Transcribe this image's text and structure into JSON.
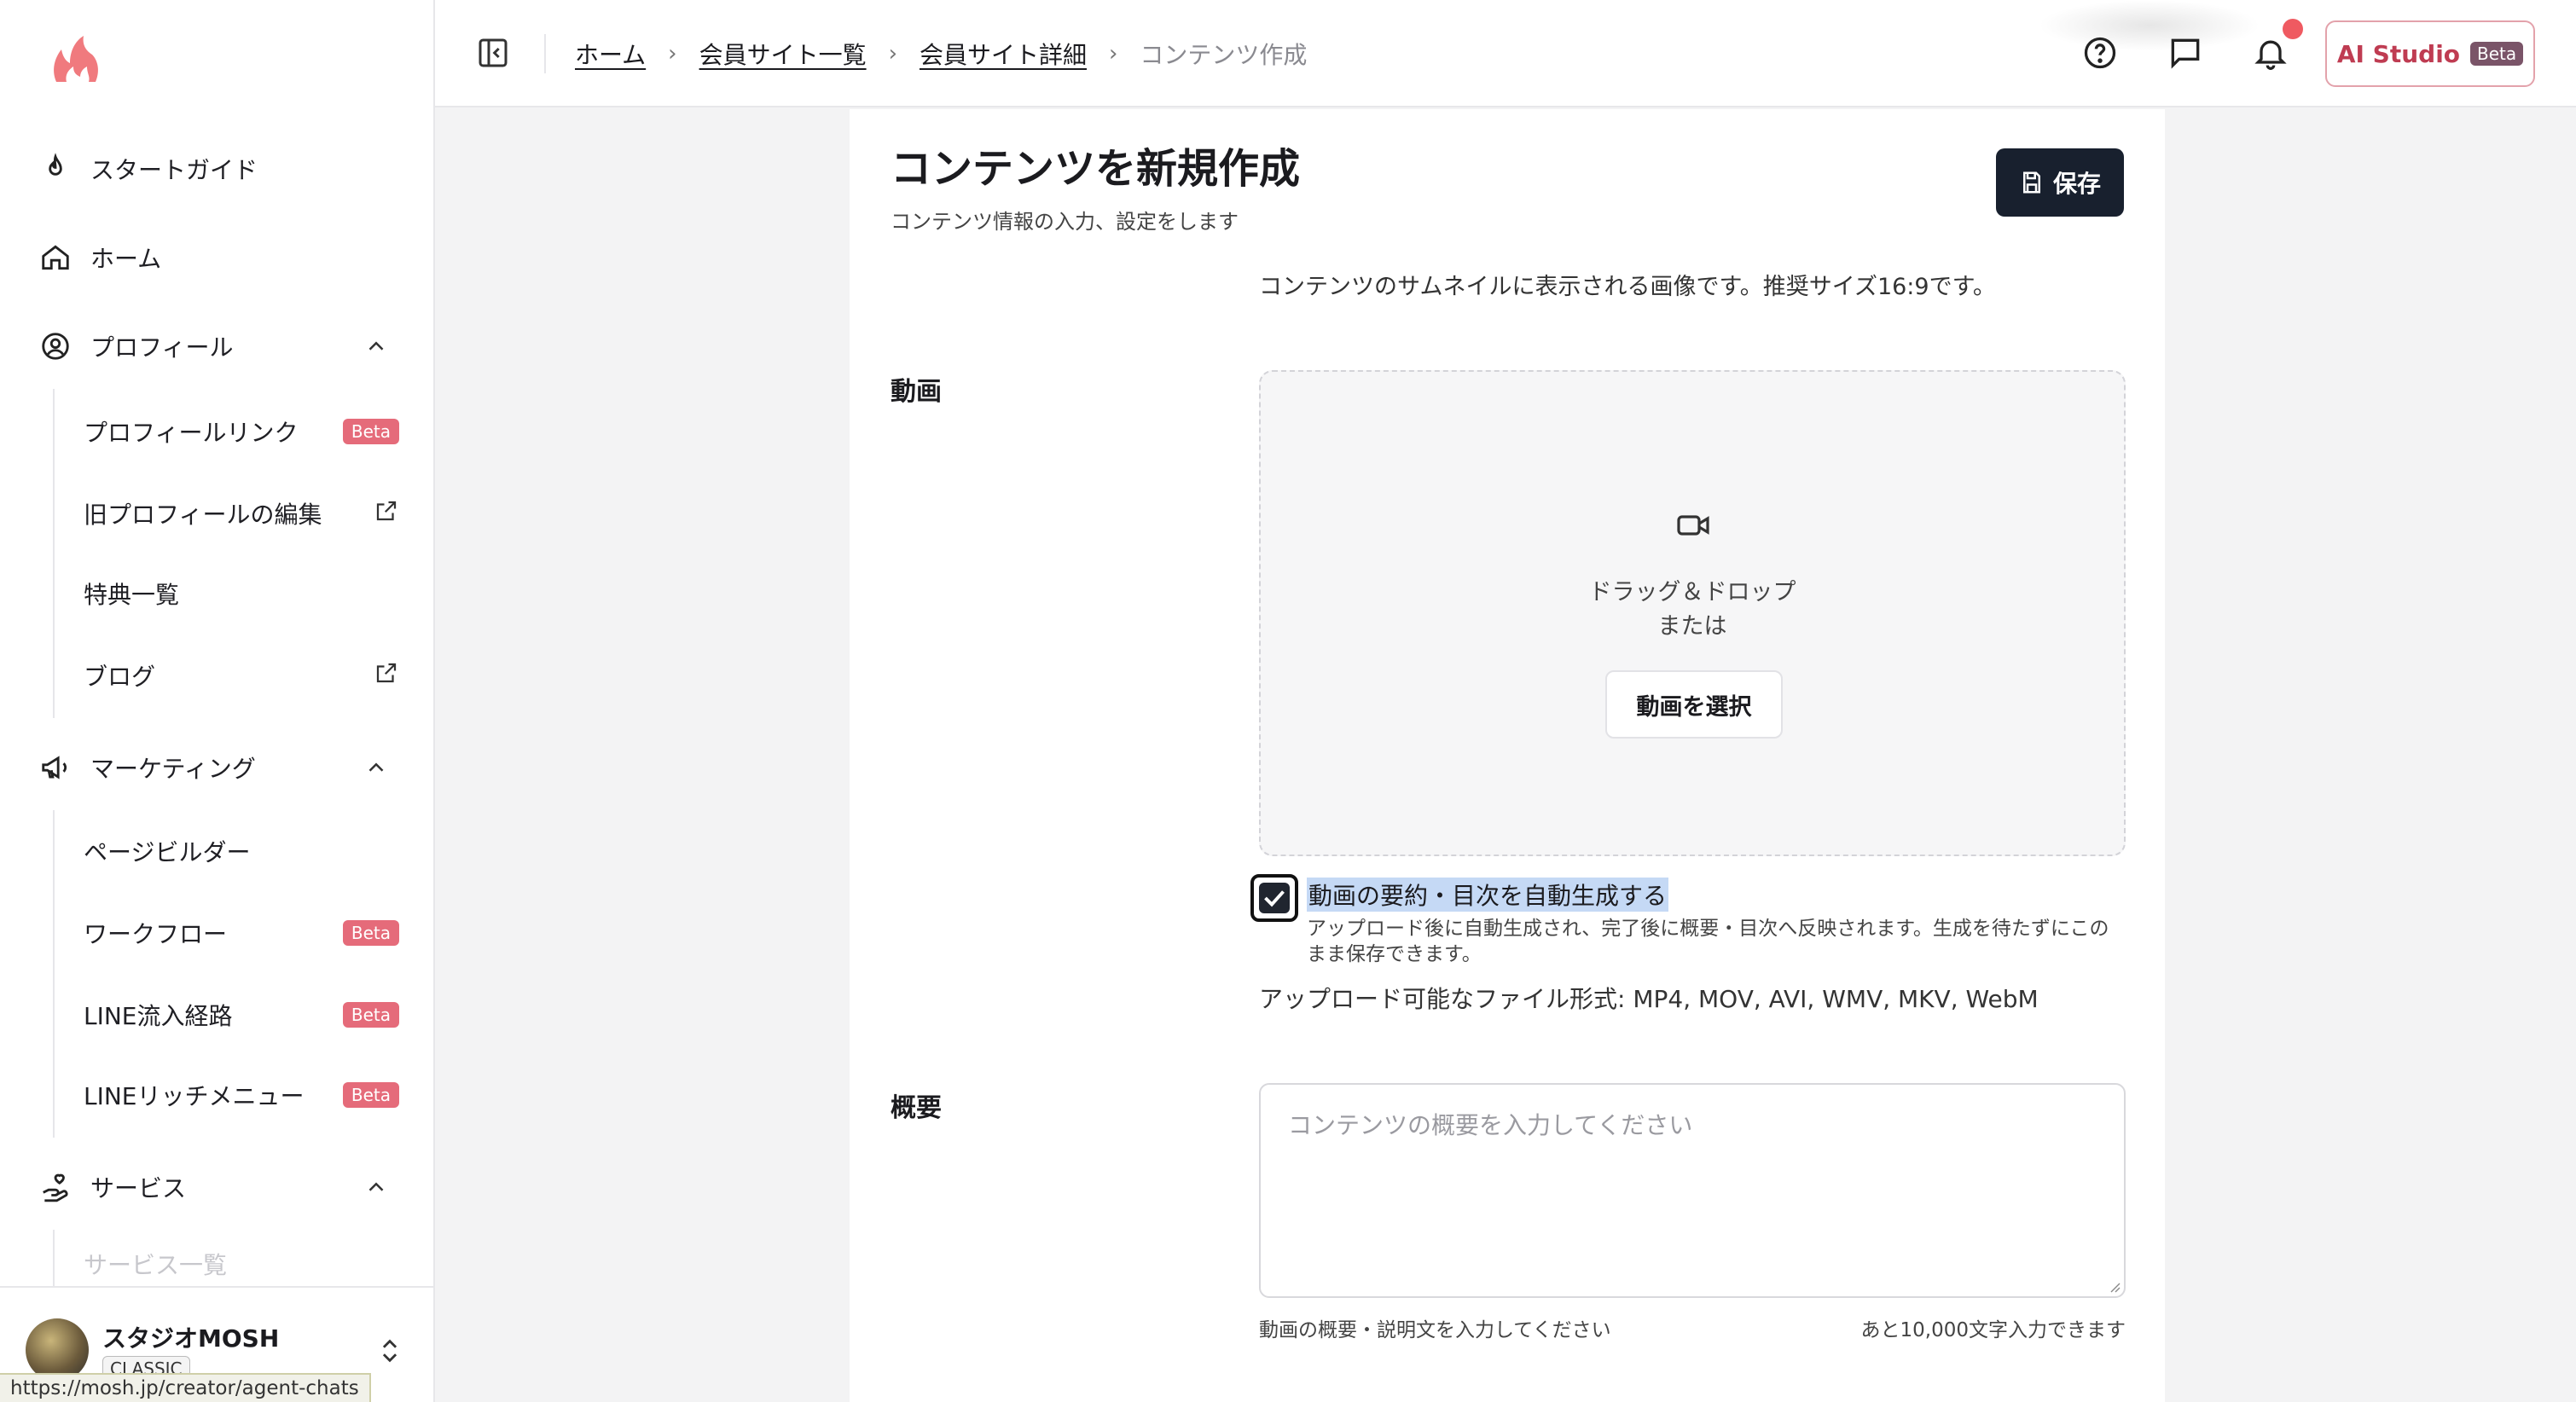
{
  "sidebar": {
    "start_guide": "スタートガイド",
    "home": "ホーム",
    "profile": "プロフィール",
    "profile_items": [
      {
        "label": "プロフィールリンク",
        "badge": "Beta"
      },
      {
        "label": "旧プロフィールの編集"
      },
      {
        "label": "特典一覧"
      },
      {
        "label": "ブログ"
      }
    ],
    "marketing": "マーケティング",
    "marketing_items": [
      {
        "label": "ページビルダー"
      },
      {
        "label": "ワークフロー",
        "badge": "Beta"
      },
      {
        "label": "LINE流入経路",
        "badge": "Beta"
      },
      {
        "label": "LINEリッチメニュー",
        "badge": "Beta"
      }
    ],
    "service": "サービス",
    "service_items": [
      {
        "label": "サービス一覧"
      }
    ],
    "account": {
      "name": "スタジオMOSH",
      "plan": "CLASSIC"
    },
    "status_url": "https://mosh.jp/creator/agent-chats"
  },
  "topbar": {
    "breadcrumbs": [
      "ホーム",
      "会員サイト一覧",
      "会員サイト詳細"
    ],
    "current": "コンテンツ作成",
    "ai_studio": "AI Studio",
    "ai_badge": "Beta"
  },
  "page": {
    "title": "コンテンツを新規作成",
    "subtitle": "コンテンツ情報の入力、設定をします",
    "save_label": "保存",
    "thumbnail_note": "コンテンツのサムネイルに表示される画像です。推奨サイズ16:9です。",
    "video": {
      "label": "動画",
      "drop_text": "ドラッグ＆ドロップ",
      "or_text": "または",
      "select_label": "動画を選択",
      "auto_label": "動画の要約・目次を自動生成する",
      "auto_checked": true,
      "auto_help": "アップロード後に自動生成され、完了後に概要・目次へ反映されます。生成を待たずにこのまま保存できます。",
      "formats": "アップロード可能なファイル形式: MP4, MOV, AVI, WMV, MKV, WebM"
    },
    "summary": {
      "label": "概要",
      "placeholder": "コンテンツの概要を入力してください",
      "help": "動画の概要・説明文を入力してください",
      "remaining": "あと10,000文字入力できます"
    }
  },
  "colors": {
    "accent": "#e56b7a",
    "primary_button": "#18202e",
    "notification": "#ef5a61"
  }
}
